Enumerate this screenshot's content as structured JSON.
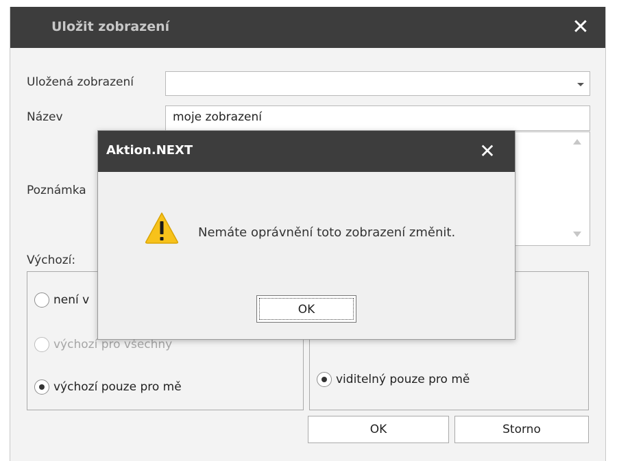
{
  "main_dialog": {
    "title": "Uložit zobrazení",
    "close_glyph": "✕",
    "saved_views_label": "Uložená zobrazení",
    "saved_views_value": "",
    "name_label": "Název",
    "name_value": "moje zobrazení",
    "note_label": "Poznámka",
    "note_value": "",
    "default_label": "Výchozí:",
    "default_options": [
      {
        "label": "není výchozí",
        "visible_text": "není v",
        "checked": false,
        "enabled": true
      },
      {
        "label": "výchozí pro všechny",
        "visible_text": "výchozí pro všechny",
        "checked": false,
        "enabled": false
      },
      {
        "label": "výchozí pouze pro mě",
        "checked": true,
        "enabled": true
      }
    ],
    "visibility_option": {
      "label": "viditelný pouze pro mě",
      "checked": true
    },
    "ok_label": "OK",
    "cancel_label": "Storno"
  },
  "message_box": {
    "title": "Aktion.NEXT",
    "close_glyph": "✕",
    "icon": "warning-icon",
    "message": "Nemáte oprávnění toto zobrazení změnit.",
    "ok_label": "OK"
  },
  "colors": {
    "titlebar": "#3d3d3d",
    "dialog_background": "#f3f3f3",
    "warning_yellow": "#f7c21b"
  }
}
